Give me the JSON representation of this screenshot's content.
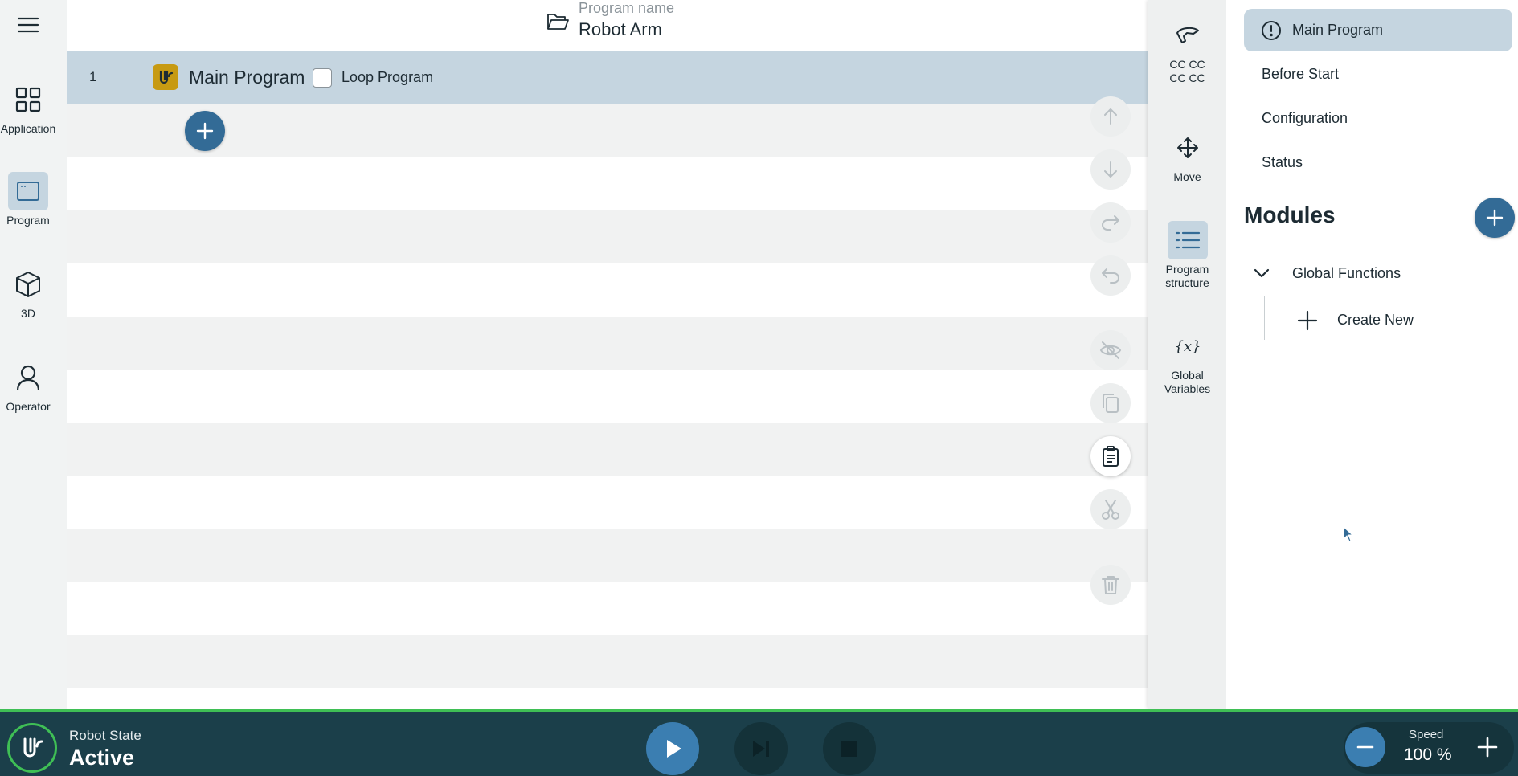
{
  "left_nav": {
    "items": [
      {
        "label": "Application",
        "icon": "grid-icon"
      },
      {
        "label": "Program",
        "icon": "program-window-icon"
      },
      {
        "label": "3D",
        "icon": "cube-icon"
      },
      {
        "label": "Operator",
        "icon": "person-icon"
      }
    ],
    "active": "Program"
  },
  "header": {
    "caption": "Program name",
    "program_name": "Robot Arm"
  },
  "program_tree": {
    "rows": [
      {
        "number": "1",
        "label": "Main Program",
        "loop_label": "Loop Program",
        "loop_checked": false
      }
    ]
  },
  "mid_panel": {
    "items": [
      {
        "label_line1": "CC CC",
        "label_line2": "CC CC",
        "icon": "tcp-gripper-icon"
      },
      {
        "label_line1": "Move",
        "label_line2": "",
        "icon": "move-arrows-icon"
      },
      {
        "label_line1": "Program",
        "label_line2": "structure",
        "icon": "list-icon"
      },
      {
        "label_line1": "Global",
        "label_line2": "Variables",
        "icon": "variable-x-icon"
      }
    ],
    "active": "Program structure"
  },
  "right_panel": {
    "items": [
      {
        "label": "Main Program"
      },
      {
        "label": "Before Start"
      },
      {
        "label": "Configuration"
      },
      {
        "label": "Status"
      }
    ],
    "modules_title": "Modules",
    "global_functions_label": "Global Functions",
    "create_new_label": "Create New"
  },
  "bottom_bar": {
    "state_caption": "Robot State",
    "state_value": "Active",
    "speed_caption": "Speed",
    "speed_value": "100 %"
  },
  "colors": {
    "accent": "#336b96",
    "selection": "#c5d5e0",
    "status_green": "#3fbf55",
    "bar_background": "#1b3f4a",
    "ur_badge": "#c79a12"
  }
}
